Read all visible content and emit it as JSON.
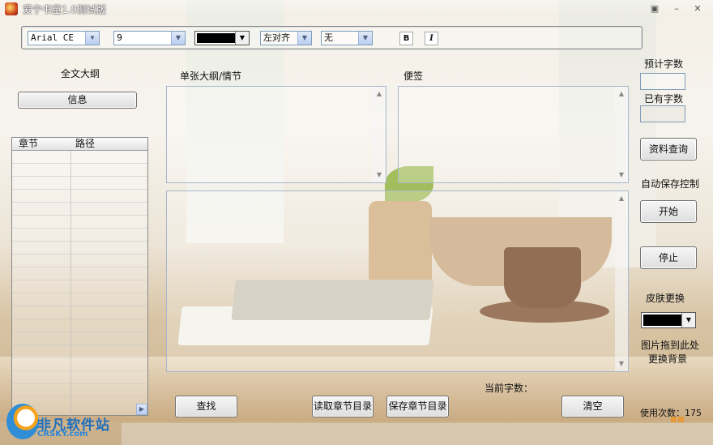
{
  "window": {
    "title": "爱宁书童1.0测试版",
    "controls": [
      "restore-icon",
      "minimize-icon",
      "close-icon"
    ]
  },
  "toolbar": {
    "font_family": "Arial CE",
    "font_size": "9",
    "font_color": "#000000",
    "alignment": "左对齐",
    "style": "无",
    "bold_label": "B",
    "italic_label": "I"
  },
  "left_panel": {
    "outline_label": "全文大纲",
    "info_button": "信息",
    "list_columns": [
      "章节",
      "路径"
    ]
  },
  "center": {
    "chapter_outline_label": "单张大纲/情节",
    "notes_label": "便签",
    "current_words_label": "当前字数：",
    "find_button": "查找",
    "read_dir_button": "读取章节目录",
    "save_dir_button": "保存章节目录",
    "clear_button": "清空"
  },
  "right_panel": {
    "expected_words_label": "预计字数",
    "existing_words_label": "已有字数",
    "lookup_button": "资料查询",
    "autosave_label": "自动保存控制",
    "start_button": "开始",
    "stop_button": "停止",
    "skin_label": "皮肤更换",
    "skin_color": "#000000",
    "drag_hint_line1": "图片拖到此处",
    "drag_hint_line2": "更换背景",
    "usage_label": "使用次数：",
    "usage_count": "175"
  },
  "watermark": {
    "cn": "非凡软件站",
    "en": "CRSKY.com"
  }
}
